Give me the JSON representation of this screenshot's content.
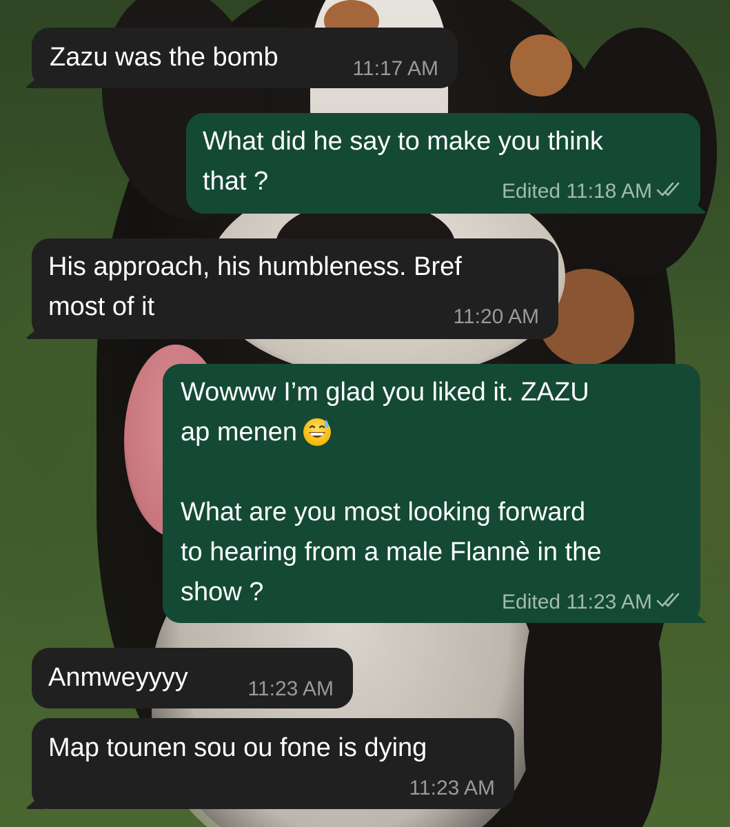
{
  "conversation": {
    "messages": [
      {
        "direction": "incoming",
        "text_lines": [
          "Zazu was the bomb"
        ],
        "time": "11:17 AM"
      },
      {
        "direction": "outgoing",
        "text_lines": [
          "What did he say to make you think",
          "that ?"
        ],
        "edited_label": "Edited",
        "time": "11:18 AM",
        "status": "read-double-check"
      },
      {
        "direction": "incoming",
        "text_lines": [
          "His approach, his humbleness. Bref",
          "most of it"
        ],
        "time": "11:20 AM"
      },
      {
        "direction": "outgoing",
        "text_lines": [
          "Wowww I’m glad you liked it. ZAZU",
          "ap menen",
          "",
          "What are you most looking forward",
          "to hearing from a male Flannè in the",
          "show ?"
        ],
        "emoji": "grinning-face-with-sweat",
        "edited_label": "Edited",
        "time": "11:23 AM",
        "status": "read-double-check"
      },
      {
        "direction": "incoming",
        "text_lines": [
          "Anmweyyyy"
        ],
        "time": "11:23 AM"
      },
      {
        "direction": "incoming",
        "text_lines": [
          "Map tounen sou ou fone is dying"
        ],
        "time": "11:23 AM"
      }
    ]
  },
  "colors": {
    "incoming_bubble": "#202020",
    "outgoing_bubble": "#144a35",
    "text": "#ffffff",
    "timestamp": "#9a9a9a"
  },
  "wallpaper": "dog-photo"
}
